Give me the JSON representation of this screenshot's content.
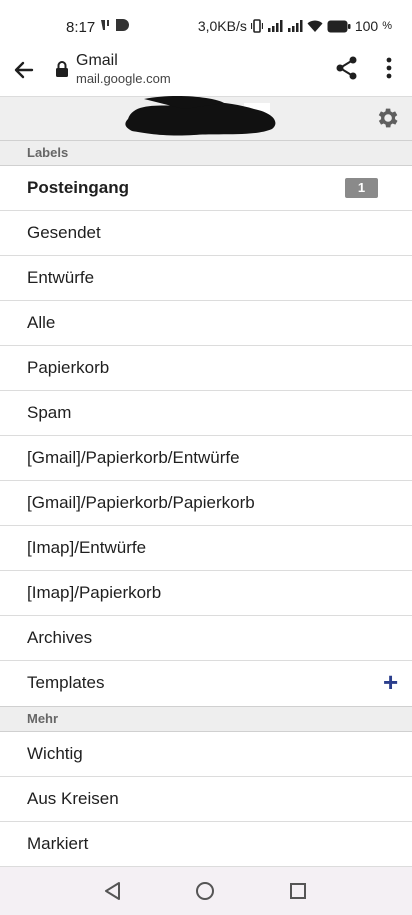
{
  "status_bar": {
    "time": "8:17",
    "speed": "3,0KB/s",
    "battery": "100"
  },
  "browser": {
    "title": "Gmail",
    "url": "mail.google.com"
  },
  "labels_section": {
    "header": "Labels",
    "items": [
      {
        "label": "Posteingang",
        "badge": "1"
      },
      {
        "label": "Gesendet"
      },
      {
        "label": "Entwürfe"
      },
      {
        "label": "Alle"
      },
      {
        "label": "Papierkorb"
      },
      {
        "label": "Spam"
      },
      {
        "label": "[Gmail]/Papierkorb/Entwürfe"
      },
      {
        "label": "[Gmail]/Papierkorb/Papierkorb"
      },
      {
        "label": "[Imap]/Entwürfe"
      },
      {
        "label": "[Imap]/Papierkorb"
      },
      {
        "label": "Archives"
      },
      {
        "label": "Templates",
        "action": "+"
      }
    ]
  },
  "more_section": {
    "header": "Mehr",
    "items": [
      {
        "label": "Wichtig"
      },
      {
        "label": "Aus Kreisen"
      },
      {
        "label": "Markiert"
      }
    ]
  },
  "colors": {
    "accent_plus": "#2b3e8c",
    "badge_bg": "#8a8a8a",
    "section_bg": "#eeeeee"
  },
  "icons": [
    "back-arrow-icon",
    "lock-icon",
    "share-icon",
    "more-vert-icon",
    "gear-icon",
    "back-nav-icon",
    "home-nav-icon",
    "recents-nav-icon"
  ]
}
